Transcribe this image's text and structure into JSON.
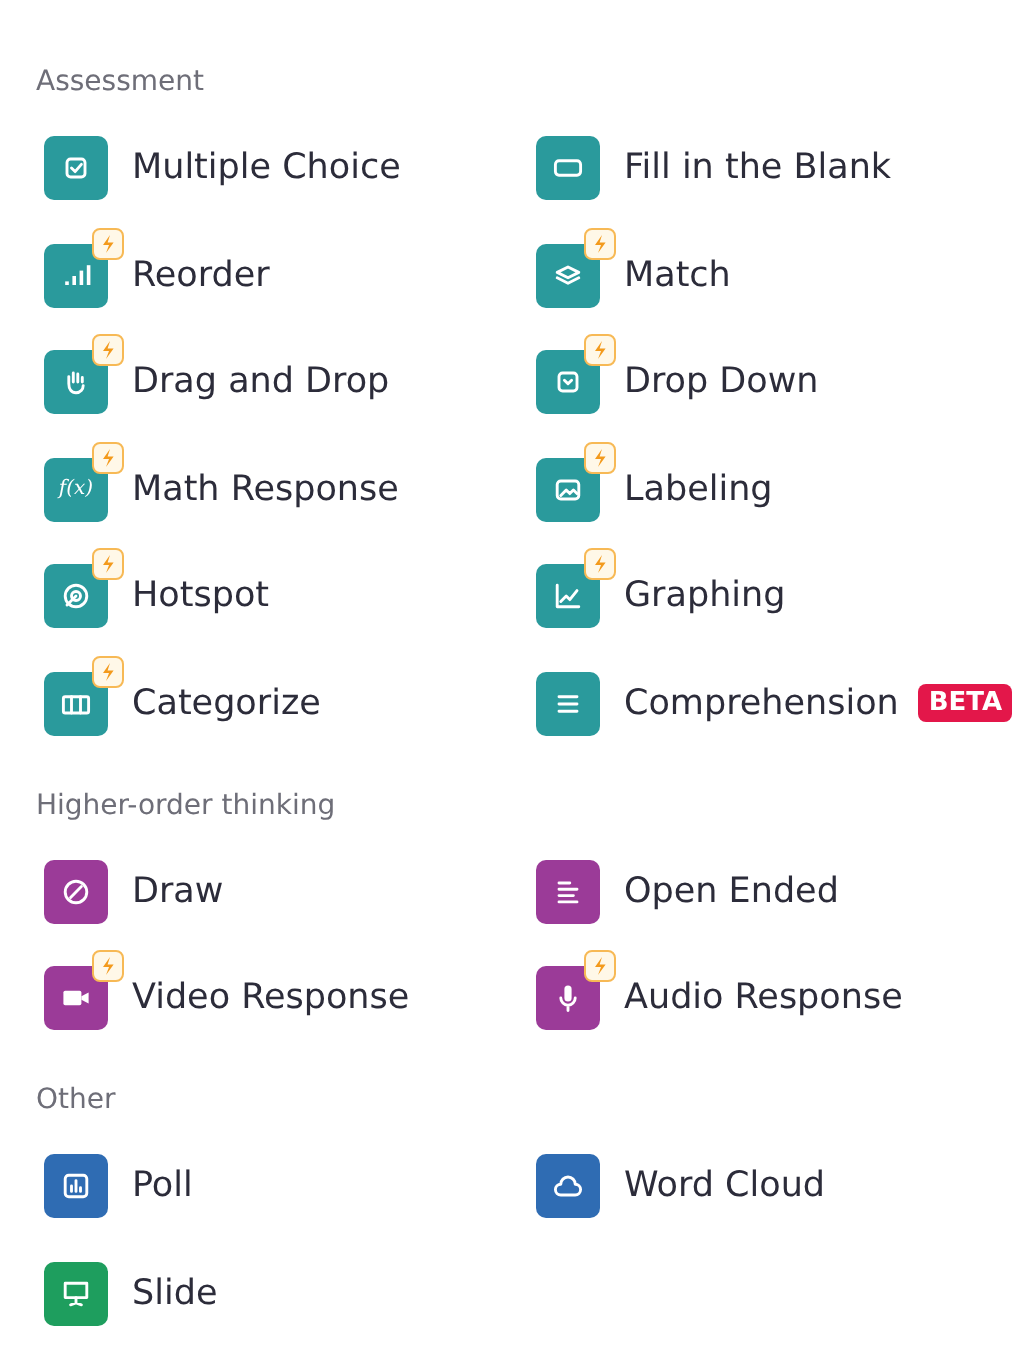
{
  "sections": [
    {
      "title": "Assessment",
      "items": [
        {
          "label": "Multiple Choice",
          "color": "#2a9a9c",
          "premium": false
        },
        {
          "label": "Fill in the Blank",
          "color": "#2a9a9c",
          "premium": false
        },
        {
          "label": "Reorder",
          "color": "#2a9a9c",
          "premium": true
        },
        {
          "label": "Match",
          "color": "#2a9a9c",
          "premium": true
        },
        {
          "label": "Drag and Drop",
          "color": "#2a9a9c",
          "premium": true
        },
        {
          "label": "Drop Down",
          "color": "#2a9a9c",
          "premium": true
        },
        {
          "label": "Math Response",
          "icon_text": "f(x)",
          "color": "#2a9a9c",
          "premium": true
        },
        {
          "label": "Labeling",
          "color": "#2a9a9c",
          "premium": true
        },
        {
          "label": "Hotspot",
          "color": "#2a9a9c",
          "premium": true
        },
        {
          "label": "Graphing",
          "color": "#2a9a9c",
          "premium": true
        },
        {
          "label": "Categorize",
          "color": "#2a9a9c",
          "premium": true
        },
        {
          "label": "Comprehension",
          "color": "#2a9a9c",
          "premium": false,
          "badge": "BETA"
        }
      ]
    },
    {
      "title": "Higher-order thinking",
      "items": [
        {
          "label": "Draw",
          "color": "#9b3b98",
          "premium": false
        },
        {
          "label": "Open Ended",
          "color": "#9b3b98",
          "premium": false
        },
        {
          "label": "Video Response",
          "color": "#9b3b98",
          "premium": true
        },
        {
          "label": "Audio Response",
          "color": "#9b3b98",
          "premium": true
        }
      ]
    },
    {
      "title": "Other",
      "items": [
        {
          "label": "Poll",
          "color": "#2f6cb3",
          "premium": false
        },
        {
          "label": "Word Cloud",
          "color": "#2f6cb3",
          "premium": false
        },
        {
          "label": "Slide",
          "color": "#1e9e5e",
          "premium": false
        }
      ]
    }
  ]
}
